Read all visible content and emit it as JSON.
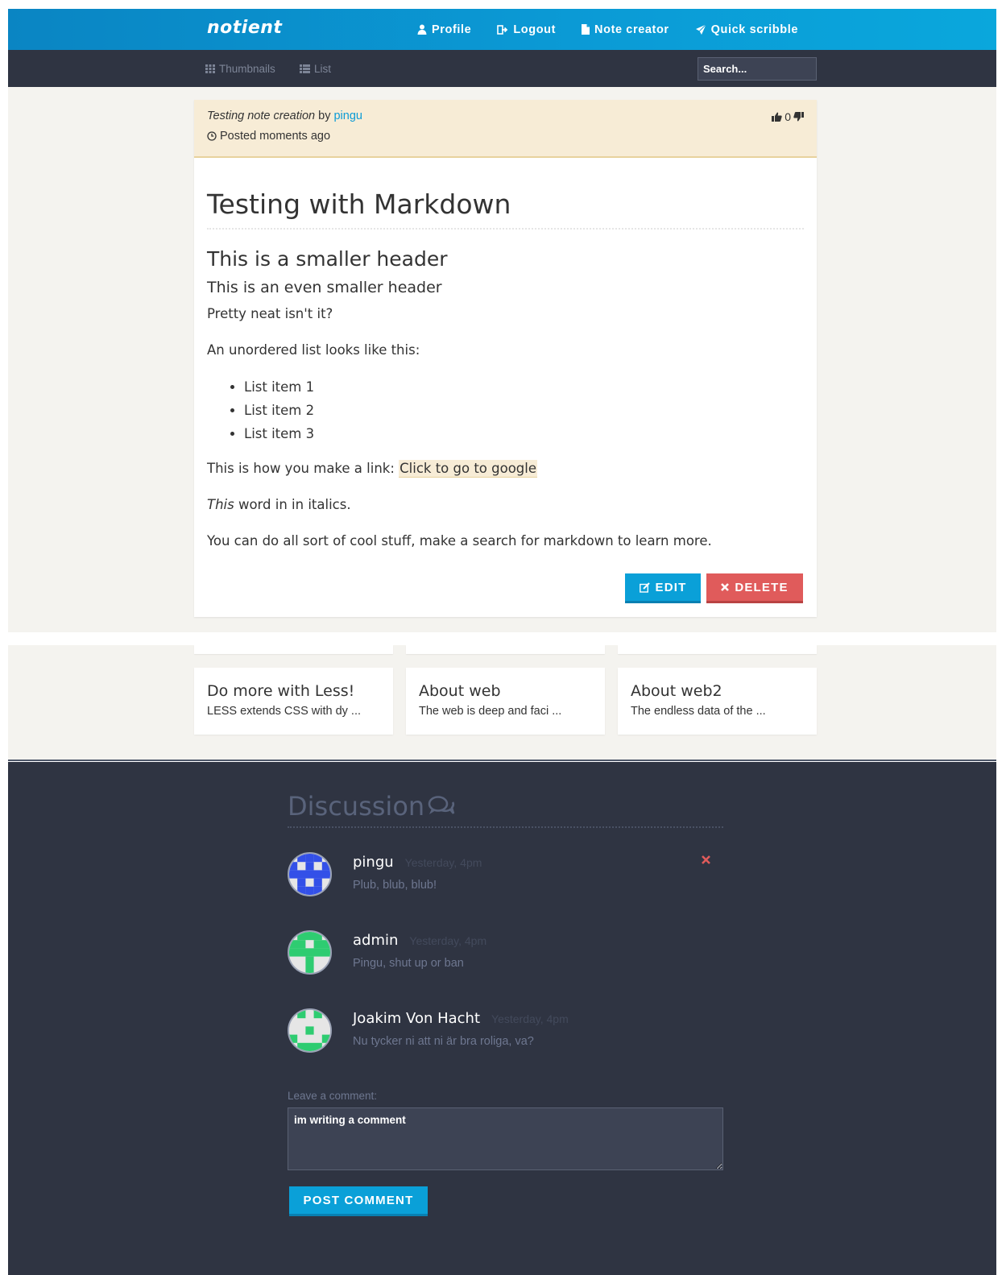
{
  "header": {
    "brand": "notient",
    "nav": [
      {
        "label": "Profile",
        "icon": "user-icon"
      },
      {
        "label": "Logout",
        "icon": "logout-icon"
      },
      {
        "label": "Note creator",
        "icon": "file-icon"
      },
      {
        "label": "Quick scribble",
        "icon": "rocket-icon"
      }
    ]
  },
  "subbar": {
    "thumbnails_label": "Thumbnails",
    "list_label": "List",
    "search_placeholder": "Search..."
  },
  "note": {
    "title": "Testing note creation",
    "by": "by",
    "author": "pingu",
    "posted": "Posted moments ago",
    "votes": "0",
    "h1": "Testing with Markdown",
    "h2": "This is a smaller header",
    "h3": "This is an even smaller header",
    "p1": "Pretty neat isn't it?",
    "p2": "An unordered list looks like this:",
    "list": [
      "List item 1",
      "List item 2",
      "List item 3"
    ],
    "link_prefix": "This is how you make a link: ",
    "link_text": "Click to go to google",
    "italic_word": "This",
    "italic_rest": " word in in italics.",
    "p_last": "You can do all sort of cool stuff, make a search for markdown to learn more.",
    "edit_label": "EDIT",
    "delete_label": "DELETE"
  },
  "related": [
    {
      "title": "Do more with Less!",
      "desc": "LESS extends CSS with dy ..."
    },
    {
      "title": "About web",
      "desc": "The web is deep and faci ..."
    },
    {
      "title": "About web2",
      "desc": "The endless data of the ..."
    }
  ],
  "discussion": {
    "title": "Discussion",
    "comments": [
      {
        "name": "pingu",
        "time": "Yesterday, 4pm",
        "text": "Plub, blub, blub!",
        "avatar_color": "#3350e8"
      },
      {
        "name": "admin",
        "time": "Yesterday, 4pm",
        "text": "Pingu, shut up or ban",
        "avatar_color": "#2ecc71"
      },
      {
        "name": "Joakim Von Hacht",
        "time": "Yesterday, 4pm",
        "text": "Nu tycker ni att ni är bra roliga, va?",
        "avatar_color": "#2ecc71"
      }
    ],
    "leave_label": "Leave a comment:",
    "comment_value": "im writing a comment",
    "post_label": "POST COMMENT"
  },
  "colors": {
    "accent": "#0aa0d8",
    "danger": "#e05b5b",
    "dark": "#2f3442",
    "highlight": "#f7ecd6"
  }
}
